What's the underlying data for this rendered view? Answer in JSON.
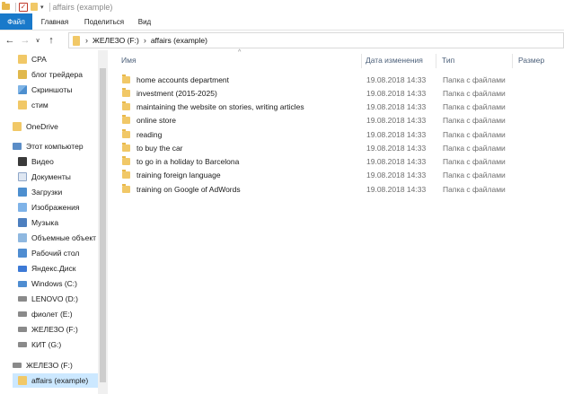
{
  "window": {
    "title": "affairs (example)"
  },
  "ribbon": {
    "tabs": [
      "Файл",
      "Главная",
      "Поделиться",
      "Вид"
    ]
  },
  "breadcrumb": {
    "parts": [
      "ЖЕЛЕЗО (F:)",
      "affairs (example)"
    ]
  },
  "sidebar": {
    "items": [
      {
        "label": "CPA",
        "icon": "folder-icon"
      },
      {
        "label": "блог трейдера",
        "icon": "chart-icon"
      },
      {
        "label": "Скриншоты",
        "icon": "picture-icon"
      },
      {
        "label": "стим",
        "icon": "folder-icon"
      },
      {
        "label": "OneDrive",
        "icon": "folder-icon"
      },
      {
        "label": "Этот компьютер",
        "icon": "computer-icon"
      },
      {
        "label": "Видео",
        "icon": "video-icon"
      },
      {
        "label": "Документы",
        "icon": "document-icon"
      },
      {
        "label": "Загрузки",
        "icon": "download-icon"
      },
      {
        "label": "Изображения",
        "icon": "pictures-icon"
      },
      {
        "label": "Музыка",
        "icon": "music-icon"
      },
      {
        "label": "Объемные объект",
        "icon": "3d-objects-icon"
      },
      {
        "label": "Рабочий стол",
        "icon": "desktop-icon"
      },
      {
        "label": "Яндекс.Диск",
        "icon": "yandex-disk-icon"
      },
      {
        "label": "Windows (C:)",
        "icon": "windows-drive-icon"
      },
      {
        "label": "LENOVO (D:)",
        "icon": "drive-icon"
      },
      {
        "label": "фиолет (E:)",
        "icon": "drive-icon"
      },
      {
        "label": "ЖЕЛЕЗО (F:)",
        "icon": "drive-icon"
      },
      {
        "label": "КИТ (G:)",
        "icon": "drive-icon"
      },
      {
        "label": "ЖЕЛЕЗО (F:)",
        "icon": "drive-icon"
      },
      {
        "label": "affairs (example)",
        "icon": "folder-icon"
      }
    ]
  },
  "columns": {
    "name": "Имя",
    "date": "Дата изменения",
    "type": "Тип",
    "size": "Размер"
  },
  "files": [
    {
      "name": "home accounts department",
      "date": "19.08.2018 14:33",
      "type": "Папка с файлами"
    },
    {
      "name": "investment (2015-2025)",
      "date": "19.08.2018 14:33",
      "type": "Папка с файлами"
    },
    {
      "name": "maintaining the website on stories, writing articles",
      "date": "19.08.2018 14:33",
      "type": "Папка с файлами"
    },
    {
      "name": "online store",
      "date": "19.08.2018 14:33",
      "type": "Папка с файлами"
    },
    {
      "name": "reading",
      "date": "19.08.2018 14:33",
      "type": "Папка с файлами"
    },
    {
      "name": "to buy the car",
      "date": "19.08.2018 14:33",
      "type": "Папка с файлами"
    },
    {
      "name": "to go in a holiday to Barcelona",
      "date": "19.08.2018 14:33",
      "type": "Папка с файлами"
    },
    {
      "name": "training foreign language",
      "date": "19.08.2018 14:33",
      "type": "Папка с файлами"
    },
    {
      "name": "training on Google of AdWords",
      "date": "19.08.2018 14:33",
      "type": "Папка с файлами"
    }
  ],
  "colors": {
    "file_tab": "#1979ca",
    "selected_row": "#cce8ff",
    "folder": "#f1c867"
  }
}
